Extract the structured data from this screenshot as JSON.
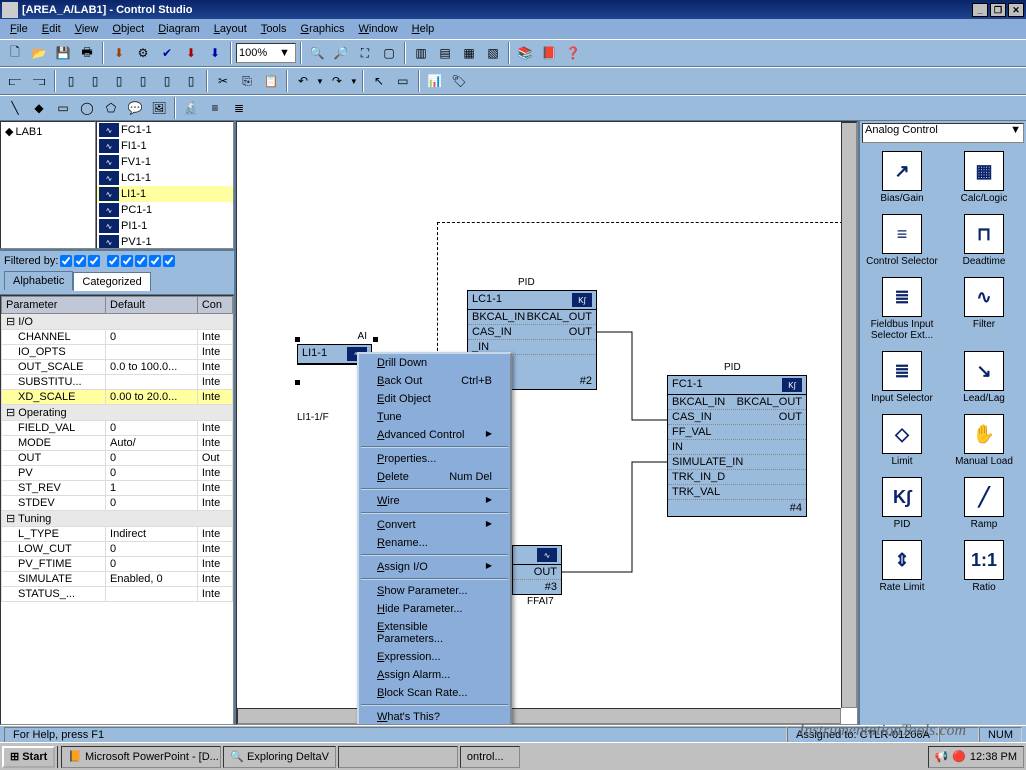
{
  "title": "[AREA_A/LAB1] - Control Studio",
  "menus": [
    "File",
    "Edit",
    "View",
    "Object",
    "Diagram",
    "Layout",
    "Tools",
    "Graphics",
    "Window",
    "Help"
  ],
  "zoom": "100%",
  "tree_root": "LAB1",
  "tags": [
    "FC1-1",
    "FI1-1",
    "FV1-1",
    "LC1-1",
    "LI1-1",
    "PC1-1",
    "PI1-1",
    "PV1-1"
  ],
  "tag_selected": "LI1-1",
  "filter_label": "Filtered by:",
  "tabs": [
    "Alphabetic",
    "Categorized"
  ],
  "tab_active": "Categorized",
  "param_headers": [
    "Parameter",
    "Default",
    "Con"
  ],
  "param_groups": [
    {
      "name": "I/O",
      "rows": [
        {
          "p": "CHANNEL",
          "d": "0",
          "c": "Inte"
        },
        {
          "p": "IO_OPTS",
          "d": "",
          "c": "Inte"
        },
        {
          "p": "OUT_SCALE",
          "d": "0.0 to 100.0...",
          "c": "Inte"
        },
        {
          "p": "SUBSTITU...",
          "d": "",
          "c": "Inte"
        },
        {
          "p": "XD_SCALE",
          "d": "0.00 to 20.0...",
          "c": "Inte",
          "sel": true
        }
      ]
    },
    {
      "name": "Operating",
      "rows": [
        {
          "p": "FIELD_VAL",
          "d": "0",
          "c": "Inte"
        },
        {
          "p": "MODE",
          "d": "Auto/",
          "c": "Inte"
        },
        {
          "p": "OUT",
          "d": "0",
          "c": "Out"
        },
        {
          "p": "PV",
          "d": "0",
          "c": "Inte"
        },
        {
          "p": "ST_REV",
          "d": "1",
          "c": "Inte"
        },
        {
          "p": "STDEV",
          "d": "0",
          "c": "Inte"
        }
      ]
    },
    {
      "name": "Tuning",
      "rows": [
        {
          "p": "L_TYPE",
          "d": "Indirect",
          "c": "Inte"
        },
        {
          "p": "LOW_CUT",
          "d": "0",
          "c": "Inte"
        },
        {
          "p": "PV_FTIME",
          "d": "0",
          "c": "Inte"
        },
        {
          "p": "SIMULATE",
          "d": "Enabled, 0",
          "c": "Inte"
        },
        {
          "p": "STATUS_...",
          "d": "",
          "c": "Inte"
        }
      ]
    }
  ],
  "blocks": {
    "ai": {
      "type": "AI",
      "name": "LI1-1",
      "wire": "LI1-1/F"
    },
    "pid1": {
      "type": "PID",
      "name": "LC1-1",
      "rows": [
        "BKCAL_IN",
        "BKCAL_OUT",
        "CAS_IN",
        "OUT"
      ],
      "num": "#2"
    },
    "pid2": {
      "type": "PID",
      "name": "FC1-1",
      "rows": [
        "BKCAL_IN",
        "BKCAL_OUT",
        "CAS_IN",
        "OUT",
        "FF_VAL",
        "IN",
        "SIMULATE_IN",
        "TRK_IN_D",
        "TRK_VAL"
      ],
      "num": "#4"
    },
    "ao": {
      "num": "#3",
      "out": "OUT",
      "wire": "FFAI7"
    }
  },
  "context_menu": [
    {
      "l": "Drill Down"
    },
    {
      "l": "Back Out",
      "s": "Ctrl+B"
    },
    {
      "l": "Edit Object"
    },
    {
      "l": "Tune"
    },
    {
      "l": "Advanced Control",
      "sub": true
    },
    {
      "sep": true
    },
    {
      "l": "Properties..."
    },
    {
      "l": "Delete",
      "s": "Num Del"
    },
    {
      "sep": true
    },
    {
      "l": "Wire",
      "sub": true
    },
    {
      "sep": true
    },
    {
      "l": "Convert",
      "sub": true
    },
    {
      "l": "Rename..."
    },
    {
      "sep": true
    },
    {
      "l": "Assign I/O",
      "sub": true
    },
    {
      "sep": true
    },
    {
      "l": "Show Parameter..."
    },
    {
      "l": "Hide Parameter..."
    },
    {
      "l": "Extensible Parameters..."
    },
    {
      "l": "Expression..."
    },
    {
      "l": "Assign Alarm..."
    },
    {
      "l": "Block Scan Rate..."
    },
    {
      "sep": true
    },
    {
      "l": "What's This?"
    }
  ],
  "palette_category": "Analog Control",
  "palette": [
    {
      "l": "Bias/Gain",
      "i": "↗"
    },
    {
      "l": "Calc/Logic",
      "i": "▦"
    },
    {
      "l": "Control Selector",
      "i": "≡"
    },
    {
      "l": "Deadtime",
      "i": "⊓"
    },
    {
      "l": "Fieldbus Input Selector Ext...",
      "i": "≣"
    },
    {
      "l": "Filter",
      "i": "∿"
    },
    {
      "l": "Input Selector",
      "i": "≣"
    },
    {
      "l": "Lead/Lag",
      "i": "↘"
    },
    {
      "l": "Limit",
      "i": "◇"
    },
    {
      "l": "Manual Load",
      "i": "✋"
    },
    {
      "l": "PID",
      "i": "K∫"
    },
    {
      "l": "Ramp",
      "i": "╱"
    },
    {
      "l": "Rate Limit",
      "i": "⇕"
    },
    {
      "l": "Ratio",
      "i": "1:1"
    }
  ],
  "status": {
    "help": "For Help, press F1",
    "assigned": "Assigned to: CTLR-01206A",
    "num": "NUM"
  },
  "taskbar": {
    "start": "Start",
    "items": [
      "Microsoft PowerPoint - [D...",
      "Exploring DeltaV",
      "",
      "ontrol..."
    ],
    "time": "12:38 PM"
  },
  "watermark": "InstrumentationTools.com"
}
